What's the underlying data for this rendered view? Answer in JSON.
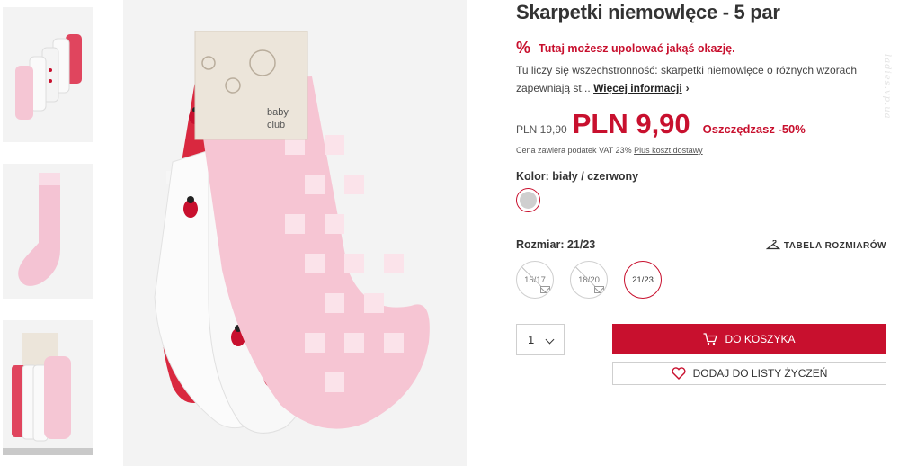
{
  "product": {
    "title": "Skarpetki niemowlęce - 5 par",
    "deal_text": "Tutaj możesz upolować jakąś okazję.",
    "description": "Tu liczy się wszechstronność: skarpetki niemowlęce o różnych wzorach zapewniają st...",
    "more_info_label": "Więcej informacji",
    "old_price": "PLN 19,90",
    "new_price": "PLN 9,90",
    "savings": "Oszczędzasz -50%",
    "vat_text": "Cena zawiera podatek VAT 23%",
    "shipping_link": "Plus koszt dostawy",
    "color_label": "Kolor: biały / czerwony",
    "size_label": "Rozmiar: 21/23",
    "size_chart_label": "TABELA ROZMIARÓW",
    "sizes": [
      {
        "label": "15/17",
        "available": false
      },
      {
        "label": "18/20",
        "available": false
      },
      {
        "label": "21/23",
        "available": true,
        "selected": true
      }
    ],
    "quantity": "1",
    "add_to_cart_label": "DO KOSZYKA",
    "wishlist_label": "DODAJ DO LISTY ŻYCZEŃ"
  },
  "packaging": {
    "brand_line1": "baby",
    "brand_line2": "club"
  },
  "watermark": "ladies.vp.ua",
  "icons": {
    "deal": "percent-icon",
    "cart": "cart-icon",
    "wishlist": "heart-icon",
    "size_chart": "hanger-icon",
    "notify": "mail-icon"
  },
  "colors": {
    "accent": "#c8102e",
    "text": "#333333",
    "image_bg": "#f3f3f3"
  }
}
